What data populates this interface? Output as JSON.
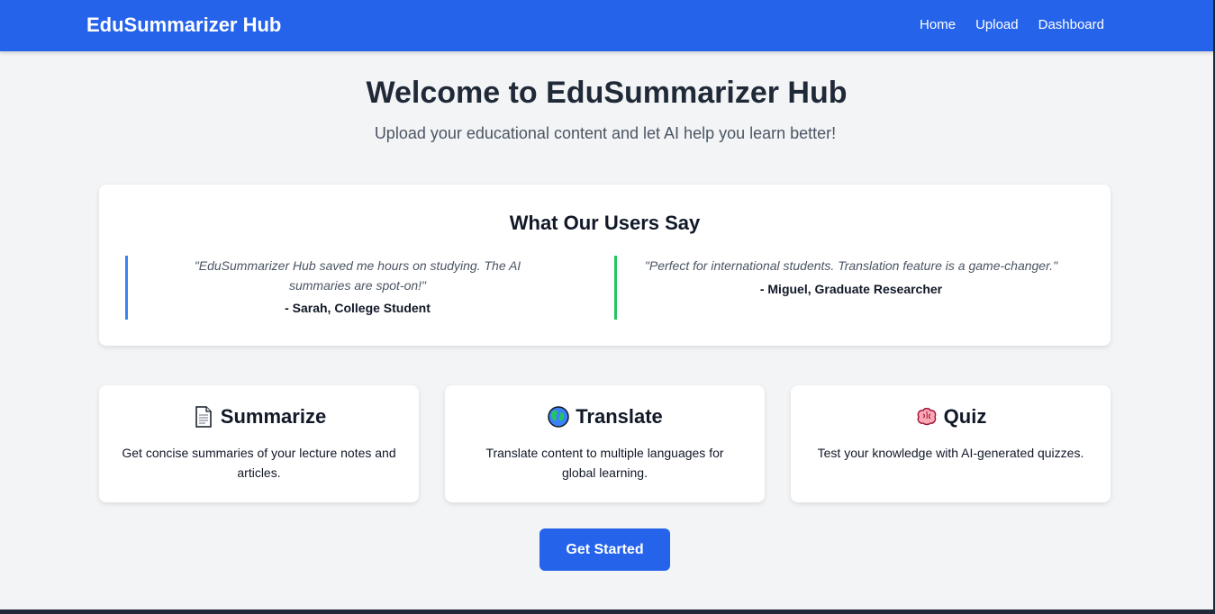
{
  "nav": {
    "brand": "EduSummarizer Hub",
    "links": [
      "Home",
      "Upload",
      "Dashboard"
    ]
  },
  "hero": {
    "title": "Welcome to EduSummarizer Hub",
    "subtitle": "Upload your educational content and let AI help you learn better!"
  },
  "testimonials": {
    "title": "What Our Users Say",
    "items": [
      {
        "quote": "\"EduSummarizer Hub saved me hours on studying. The AI summaries are spot-on!\"",
        "author": "- Sarah, College Student",
        "accent": "#3b82f6"
      },
      {
        "quote": "\"Perfect for international students. Translation feature is a game-changer.\"",
        "author": "- Miguel, Graduate Researcher",
        "accent": "#22c55e"
      }
    ]
  },
  "features": [
    {
      "icon": "document-icon",
      "title": "Summarize",
      "desc": "Get concise summaries of your lecture notes and articles."
    },
    {
      "icon": "globe-icon",
      "title": "Translate",
      "desc": "Translate content to multiple languages for global learning."
    },
    {
      "icon": "brain-icon",
      "title": "Quiz",
      "desc": "Test your knowledge with AI-generated quizzes."
    }
  ],
  "cta": {
    "label": "Get Started"
  },
  "colors": {
    "primary": "#2563eb",
    "background": "#f3f4f6"
  }
}
